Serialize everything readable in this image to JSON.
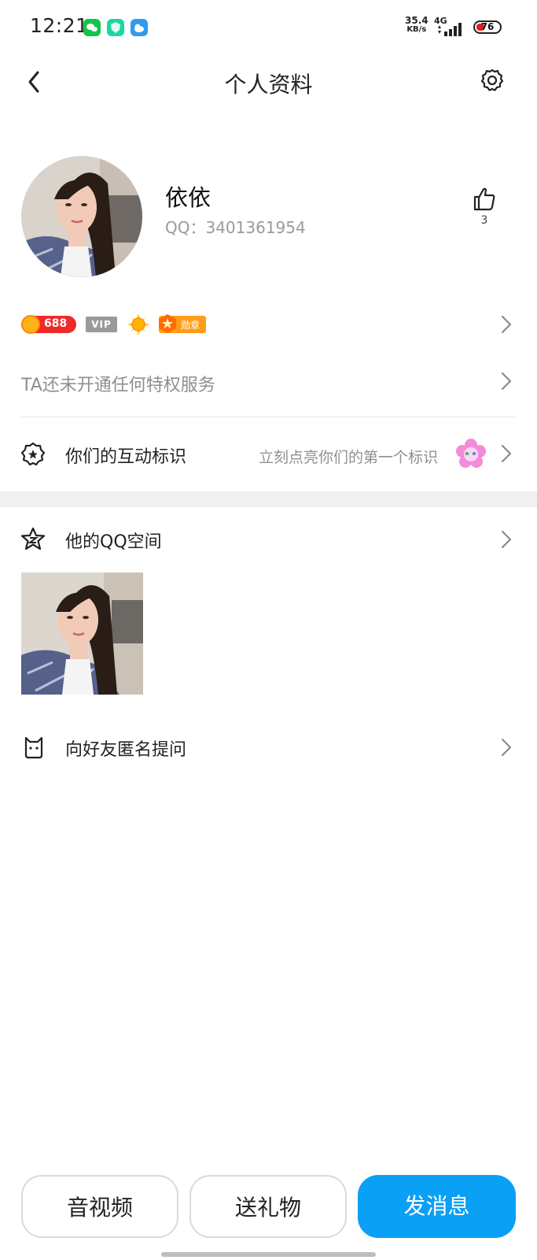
{
  "status_bar": {
    "time": "12:21",
    "net_speed_value": "35.4",
    "net_speed_unit": "KB/s",
    "network_type": "4G",
    "battery": "76"
  },
  "header": {
    "title": "个人资料"
  },
  "profile": {
    "nickname": "依依",
    "qq_number": "QQ：3401361954",
    "like_count": "3"
  },
  "badges": {
    "level_number": "688",
    "vip_label": "VIP",
    "medal_label": "勋章"
  },
  "privilege_text": "TA还未开通任何特权服务",
  "interaction_mark": {
    "label": "你们的互动标识",
    "hint": "立刻点亮你们的第一个标识"
  },
  "qzone": {
    "label": "他的QQ空间"
  },
  "anonymous_question": {
    "label": "向好友匿名提问"
  },
  "bottom_buttons": {
    "audio_video": "音视频",
    "gift": "送礼物",
    "message": "发消息"
  },
  "colors": {
    "primary": "#0aa0f6",
    "level_badge": "#ef2a2a",
    "medal_badge": "#ff9d1a"
  }
}
